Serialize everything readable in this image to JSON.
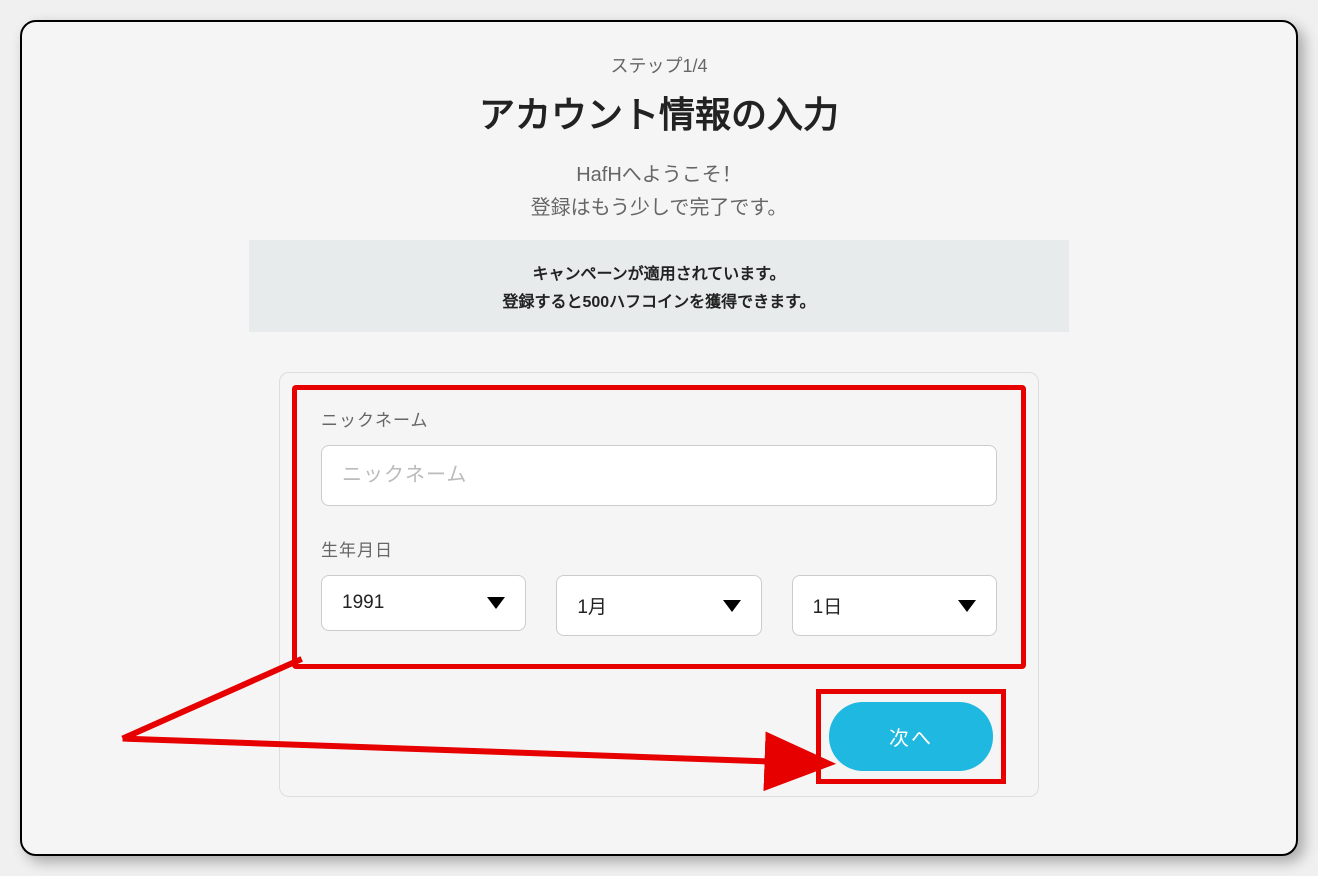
{
  "header": {
    "step": "ステップ1/4",
    "title": "アカウント情報の入力",
    "welcome1": "HafHへようこそ！",
    "welcome2": "登録はもう少しで完了です。"
  },
  "campaign": {
    "line1": "キャンペーンが適用されています。",
    "line2": "登録すると500ハフコインを獲得できます。"
  },
  "form": {
    "nickname": {
      "label": "ニックネーム",
      "placeholder": "ニックネーム",
      "value": ""
    },
    "birthdate": {
      "label": "生年月日",
      "year": "1991",
      "month": "1月",
      "day": "1日"
    }
  },
  "buttons": {
    "next": "次へ"
  }
}
